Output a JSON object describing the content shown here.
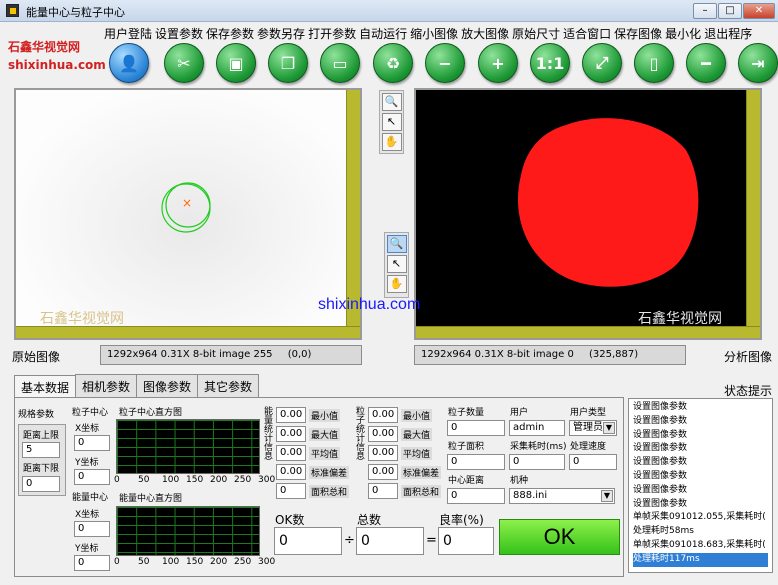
{
  "window": {
    "title": "能量中心与粒子中心",
    "min": "–",
    "max": "□",
    "close": "✕"
  },
  "brand": {
    "line1": "石鑫华视觉网",
    "line2": "shixinhua.com",
    "stamp": "石鑫华视觉网",
    "url": "shixinhua.com"
  },
  "menu": [
    "用户登陆",
    "设置参数",
    "保存参数",
    "参数另存",
    "打开参数",
    "自动运行",
    "缩小图像",
    "放大图像",
    "原始尺寸",
    "适合窗口",
    "保存图像",
    "最小化",
    "退出程序"
  ],
  "toolbar": [
    {
      "name": "user-login-icon",
      "glyph": "👤"
    },
    {
      "name": "settings-tools-icon",
      "glyph": "✂"
    },
    {
      "name": "save-disk-icon",
      "glyph": "▣"
    },
    {
      "name": "document-copy-icon",
      "glyph": "❐"
    },
    {
      "name": "open-folder-icon",
      "glyph": "▭"
    },
    {
      "name": "recycle-run-icon",
      "glyph": "♻"
    },
    {
      "name": "zoom-out-icon",
      "glyph": "−"
    },
    {
      "name": "zoom-in-icon",
      "glyph": "+"
    },
    {
      "name": "zoom-1-1-icon",
      "glyph": "1:1"
    },
    {
      "name": "fit-window-icon",
      "glyph": "⤢"
    },
    {
      "name": "save-image-icon",
      "glyph": "▯"
    },
    {
      "name": "minimize-icon",
      "glyph": "━"
    },
    {
      "name": "exit-icon",
      "glyph": "⇥"
    }
  ],
  "images": {
    "left_label": "原始图像",
    "right_label": "分析图像",
    "left_status": "1292x964 0.31X 8-bit image 255",
    "left_coords": "(0,0)",
    "right_status": "1292x964 0.31X 8-bit image 0",
    "right_coords": "(325,887)",
    "marker": "×"
  },
  "tools": {
    "zoom": "🔍",
    "select": "↖",
    "pan": "✋"
  },
  "tabs": [
    "基本数据",
    "相机参数",
    "图像参数",
    "其它参数"
  ],
  "status_label": "状态提示",
  "spec": {
    "title": "规格参数",
    "upper_label": "距离上限",
    "upper_value": "5",
    "lower_label": "距离下限",
    "lower_value": "0"
  },
  "particle": {
    "title": "粒子中心",
    "x_label": "X坐标",
    "x_value": "0",
    "y_label": "Y坐标",
    "y_value": "0",
    "hist_title": "粒子中心直方图",
    "side_label": "粒子统计信息"
  },
  "energy": {
    "title": "能量中心",
    "x_label": "X坐标",
    "x_value": "0",
    "y_label": "Y坐标",
    "y_value": "0",
    "hist_title": "能量中心直方图",
    "side_label": "能量统计信息"
  },
  "hist_ticks": [
    "0",
    "50",
    "100",
    "150",
    "200",
    "250",
    "300"
  ],
  "stats_labels": [
    "最小值",
    "最大值",
    "平均值",
    "标准偏差",
    "面积总和"
  ],
  "energy_stats": [
    "0.00",
    "0.00",
    "0.00",
    "0.00",
    "0"
  ],
  "particle_stats": [
    "0.00",
    "0.00",
    "0.00",
    "0.00",
    "0"
  ],
  "info": {
    "count_label": "粒子数量",
    "count_value": "0",
    "user_label": "用户",
    "user_value": "admin",
    "usertype_label": "用户类型",
    "usertype_value": "管理员",
    "area_label": "粒子面积",
    "area_value": "0",
    "acq_label": "采集耗时(ms)",
    "acq_value": "0",
    "speed_label": "处理速度",
    "speed_value": "0",
    "dist_label": "中心距离",
    "dist_value": "0",
    "model_label": "机种",
    "model_value": "888.ini"
  },
  "counts": {
    "ok_label": "OK数",
    "ok_value": "0",
    "total_label": "总数",
    "total_value": "0",
    "yield_label": "良率(%)",
    "yield_value": "0",
    "div": "÷",
    "eq": "="
  },
  "result": "OK",
  "log": [
    "设置图像参数",
    "设置图像参数",
    "设置图像参数",
    "设置图像参数",
    "设置图像参数",
    "设置图像参数",
    "设置图像参数",
    "设置图像参数",
    "单帧采集091012.055,采集耗时(",
    "处理耗时58ms",
    "单帧采集091018.683,采集耗时(",
    "处理耗时117ms"
  ],
  "colors": {
    "accent_green": "#34c21a",
    "scroll_olive": "#b9b930",
    "particle_red": "#ff1a1a",
    "circle_green": "#22cc22"
  }
}
